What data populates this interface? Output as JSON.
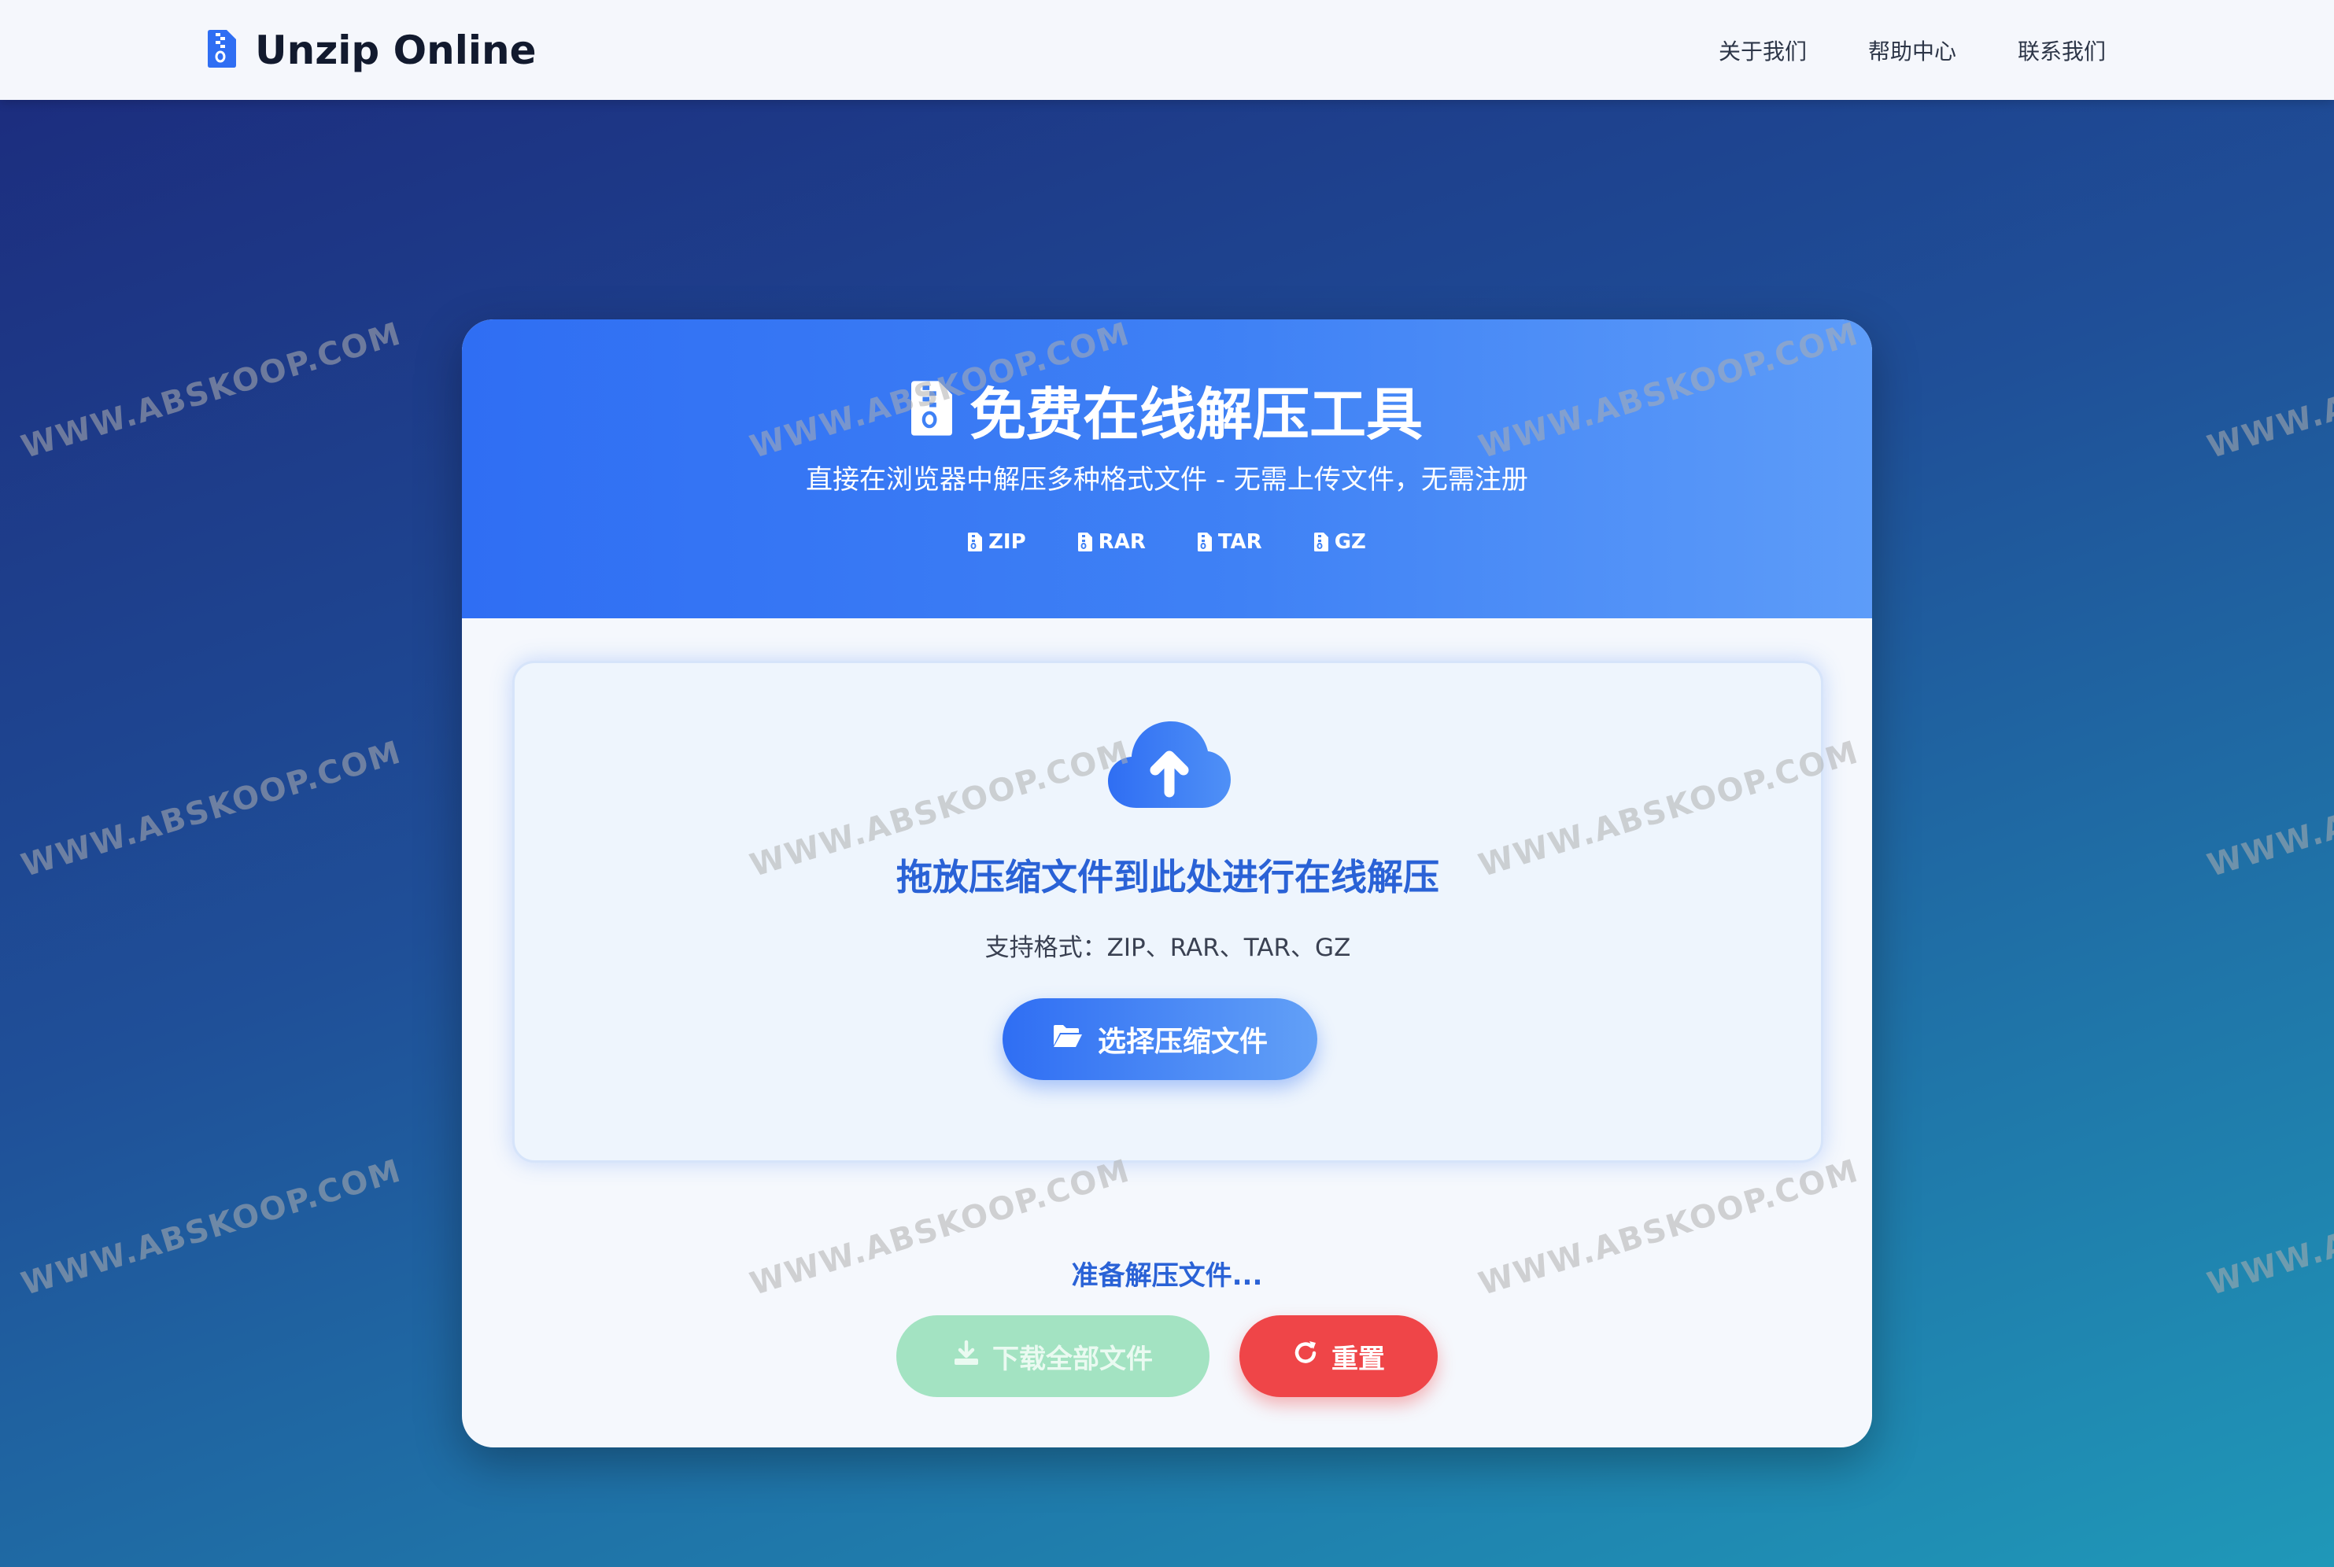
{
  "header": {
    "brand": "Unzip Online",
    "nav": [
      "关于我们",
      "帮助中心",
      "联系我们"
    ]
  },
  "hero": {
    "title": "免费在线解压工具",
    "subtitle": "直接在浏览器中解压多种格式文件 - 无需上传文件，无需注册",
    "formats": [
      "ZIP",
      "RAR",
      "TAR",
      "GZ"
    ]
  },
  "dropzone": {
    "title": "拖放压缩文件到此处进行在线解压",
    "hint": "支持格式：ZIP、RAR、TAR、GZ",
    "select_label": "选择压缩文件"
  },
  "status_text": "准备解压文件...",
  "actions": {
    "download_label": "下载全部文件",
    "reset_label": "重置"
  },
  "watermark": "WWW.ABSKOOP.COM",
  "colors": {
    "accent": "#2f6ef3",
    "download": "#a3e3c2",
    "reset": "#ef4548"
  }
}
